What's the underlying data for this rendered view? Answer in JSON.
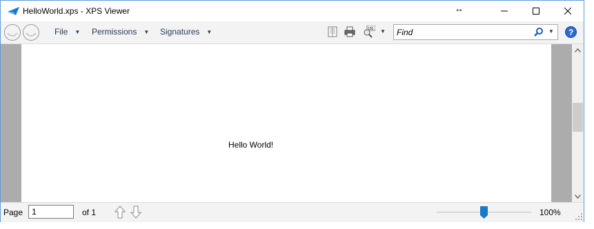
{
  "window": {
    "title": "HelloWorld.xps - XPS Viewer"
  },
  "toolbar": {
    "menus": [
      {
        "label": "File"
      },
      {
        "label": "Permissions"
      },
      {
        "label": "Signatures"
      }
    ],
    "find_placeholder": "Find"
  },
  "document": {
    "text": "Hello World!"
  },
  "statusbar": {
    "page_label": "Page",
    "page_value": "1",
    "of_label": "of 1",
    "zoom_label": "100%",
    "zoom_level_percent": 100
  },
  "colors": {
    "accent": "#1979ca",
    "menu_text": "#1e395b",
    "document_bg": "#acacac"
  }
}
